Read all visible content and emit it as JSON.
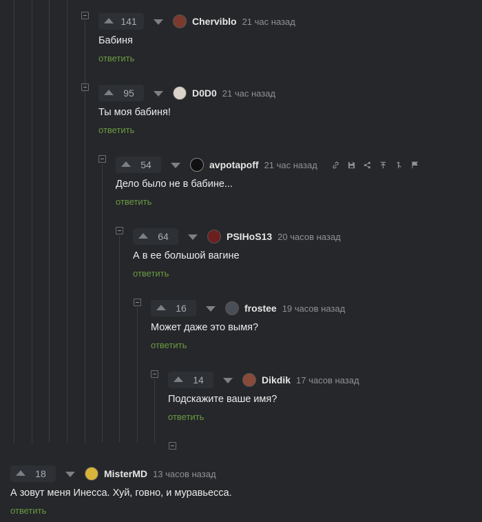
{
  "comments": [
    {
      "score": "141",
      "user": "Cherviblo",
      "time": "21 час назад",
      "text": "Бабиня",
      "reply": "ответить",
      "avatar_color": "#7a3b2e"
    },
    {
      "score": "95",
      "user": "D0D0",
      "time": "21 час назад",
      "text": "Ты моя бабиня!",
      "reply": "ответить",
      "avatar_color": "#d9d3c9"
    },
    {
      "score": "54",
      "user": "avpotapoff",
      "time": "21 час назад",
      "text": "Дело было не в бабине...",
      "reply": "ответить",
      "avatar_color": "#111111"
    },
    {
      "score": "64",
      "user": "PSIHoS13",
      "time": "20 часов назад",
      "text": "А в ее большой вагине",
      "reply": "ответить",
      "avatar_color": "#6b1f1f"
    },
    {
      "score": "16",
      "user": "frostee",
      "time": "19 часов назад",
      "text": "Может даже это вымя?",
      "reply": "ответить",
      "avatar_color": "#4a4f57"
    },
    {
      "score": "14",
      "user": "Dikdik",
      "time": "17 часов назад",
      "text": "Подскажите ваше имя?",
      "reply": "ответить",
      "avatar_color": "#8a4a3a"
    },
    {
      "score": "18",
      "user": "MisterMD",
      "time": "13 часов назад",
      "text": "А зовут меня Инесса. Хуй, говно, и муравьесса.",
      "reply": "ответить",
      "avatar_color": "#d8b43a"
    }
  ],
  "toolbar_icons": [
    "link-icon",
    "save-icon",
    "share-icon",
    "go-to-parent-icon",
    "branch-icon",
    "report-flag-icon"
  ],
  "colors": {
    "background": "#25272a",
    "reply_link": "#6c9a43",
    "thread_line": "#3a3d41"
  }
}
